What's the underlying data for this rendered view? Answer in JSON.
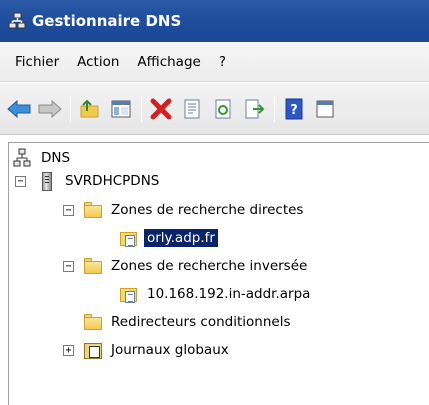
{
  "window": {
    "title": "Gestionnaire DNS"
  },
  "menu": {
    "items": [
      "Fichier",
      "Action",
      "Affichage",
      "?"
    ]
  },
  "toolbar": {
    "buttons": [
      "back-arrow-icon",
      "forward-arrow-icon",
      "up-folder-icon",
      "show-hide-console-tree-icon",
      "delete-icon",
      "properties-icon",
      "refresh-icon",
      "export-list-icon",
      "help-icon",
      "console-icon"
    ]
  },
  "tree": {
    "root": "DNS",
    "server": "SVRDHCPDNS",
    "forward_zones": "Zones de recherche directes",
    "forward_zone_item": "orly.adp.fr",
    "reverse_zones": "Zones de recherche inversée",
    "reverse_zone_item": "10.168.192.in-addr.arpa",
    "conditional_forwarders": "Redirecteurs conditionnels",
    "global_logs": "Journaux globaux",
    "expander_minus": "−",
    "expander_plus": "+"
  },
  "colors": {
    "titlebar": "#1f4e9c",
    "selection": "#0a246a"
  }
}
